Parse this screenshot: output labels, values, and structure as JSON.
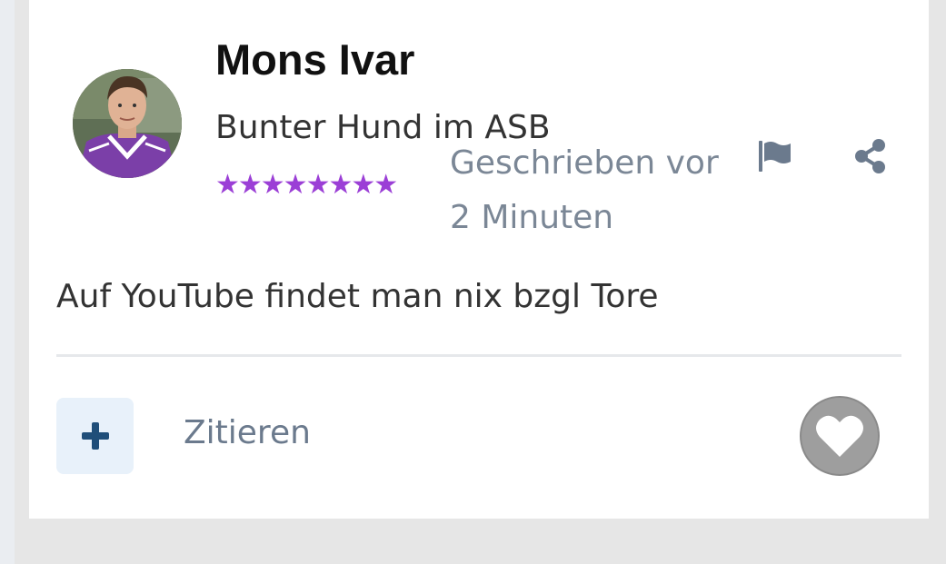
{
  "post": {
    "author": {
      "name": "Mons Ivar",
      "rank": "Bunter Hund im ASB",
      "stars": "★★★★★★★★"
    },
    "timestamp": "Geschrieben vor 2 Minuten",
    "content": "Auf YouTube findet man nix bzgl Tore"
  },
  "actions": {
    "quote_label": "Zitieren",
    "flag_icon": "flag-icon",
    "share_icon": "share-icon",
    "plus_icon": "plus-icon",
    "like_icon": "heart-icon"
  },
  "colors": {
    "stars": "#9b3fd6",
    "muted": "#7b8796",
    "plus_bg": "#e8f1fa",
    "plus_icon": "#1f4e79",
    "like_bg": "#9e9e9e"
  }
}
